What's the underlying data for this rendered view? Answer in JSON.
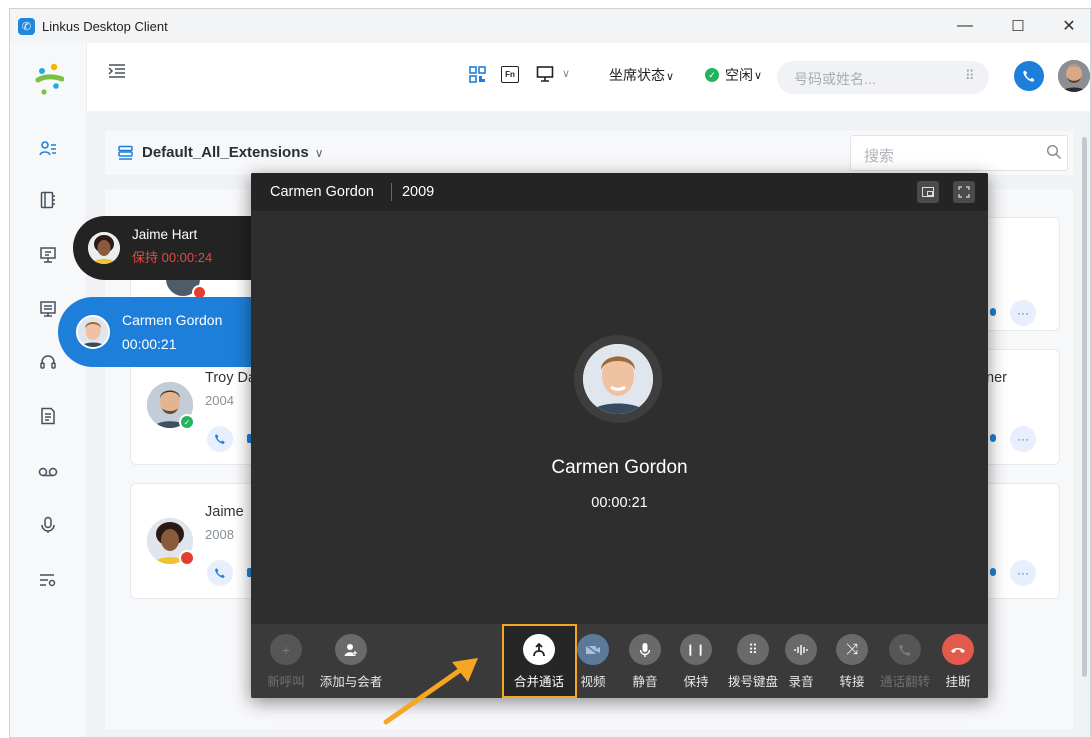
{
  "window": {
    "title": "Linkus Desktop Client",
    "minimize": "—",
    "maximize": "☐",
    "close": "✕"
  },
  "topbar": {
    "agent_status_label": "坐席状态",
    "presence_label": "空闲",
    "search_placeholder": "号码或姓名...",
    "chevron": "∨"
  },
  "group": {
    "name": "Default_All_Extensions",
    "search_placeholder": "搜索"
  },
  "contacts": [
    {
      "name": "Troy Da",
      "ext": "2004",
      "status": "available"
    },
    {
      "name": "Jaime",
      "ext": "2008",
      "status": "busy"
    },
    {
      "name_partial_right": "ner"
    }
  ],
  "floating_calls": [
    {
      "name": "Jaime Hart",
      "status_text": "保持 00:00:24"
    },
    {
      "name": "Carmen Gordon",
      "status_text": "00:00:21"
    }
  ],
  "call_window": {
    "contact_name": "Carmen Gordon",
    "extension": "2009",
    "timer": "00:00:21",
    "toolbar": [
      {
        "label": "新呼叫",
        "icon": "plus-icon",
        "enabled": false
      },
      {
        "label": "添加与会者",
        "icon": "add-participant-icon",
        "enabled": true
      },
      {
        "label": "合并通话",
        "icon": "merge-icon",
        "enabled": true,
        "highlighted": true
      },
      {
        "label": "视频",
        "icon": "video-off-icon",
        "enabled": true
      },
      {
        "label": "静音",
        "icon": "microphone-icon",
        "enabled": true
      },
      {
        "label": "保持",
        "icon": "pause-icon",
        "enabled": true
      },
      {
        "label": "拨号键盘",
        "icon": "dialpad-icon",
        "enabled": true
      },
      {
        "label": "录音",
        "icon": "record-icon",
        "enabled": true
      },
      {
        "label": "转接",
        "icon": "transfer-icon",
        "enabled": true
      },
      {
        "label": "通话翻转",
        "icon": "flip-call-icon",
        "enabled": false
      },
      {
        "label": "挂断",
        "icon": "hangup-icon",
        "enabled": true
      }
    ]
  },
  "colors": {
    "brand_blue": "#1d7fd9",
    "hangup_red": "#e25a4c",
    "highlight_orange": "#f5a623",
    "available_green": "#22b35e",
    "busy_red": "#e43d30",
    "hold_text": "#e54a3d"
  }
}
